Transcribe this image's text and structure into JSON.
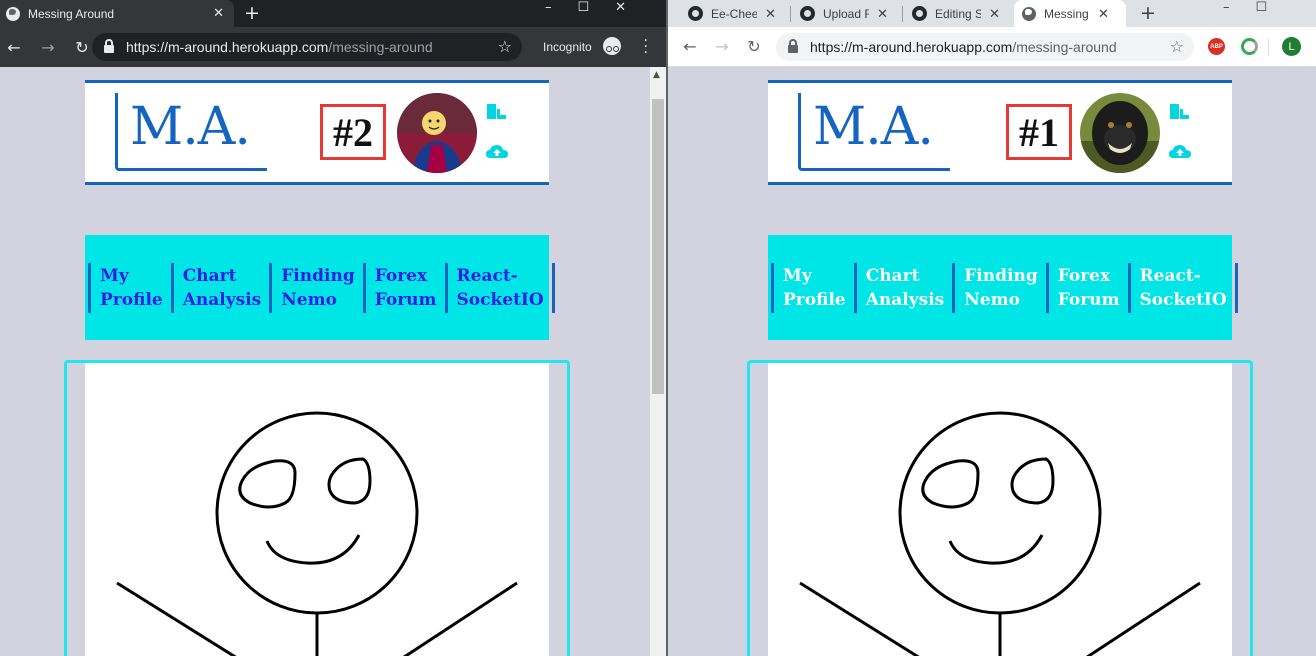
{
  "left_window": {
    "tab_title": "Messing Around",
    "url_host": "https://m-around.herokuapp.com",
    "url_path": "/messing-around",
    "incognito_label": "Incognito",
    "page": {
      "logo": "M.A.",
      "rank": "#2",
      "nav": [
        "My\nProfile",
        "Chart\nAnalysis",
        "Finding\nNemo",
        "Forex\nForum",
        "React-\nSocketIO"
      ]
    }
  },
  "right_window": {
    "tabs": [
      {
        "title": "Ee-Chee",
        "icon": "github-icon"
      },
      {
        "title": "Upload F",
        "icon": "github-icon"
      },
      {
        "title": "Editing S",
        "icon": "github-icon"
      },
      {
        "title": "Messing",
        "icon": "globe-icon"
      }
    ],
    "url_host": "https://m-around.herokuapp.com",
    "url_path": "/messing-around",
    "abp_label": "ABP",
    "avatar_initial": "L",
    "page": {
      "logo": "M.A.",
      "rank": "#1",
      "nav": [
        "My\nProfile",
        "Chart\nAnalysis",
        "Finding\nNemo",
        "Forex\nForum",
        "React-\nSocketIO"
      ]
    }
  },
  "colors": {
    "brand_blue": "#1565c0",
    "nav_cyan": "#00e5e5",
    "rank_border": "#e53935",
    "canvas_frame": "#22e5ee",
    "nav_link_left": "#2e1ee8",
    "nav_link_right": "#ffffff"
  }
}
